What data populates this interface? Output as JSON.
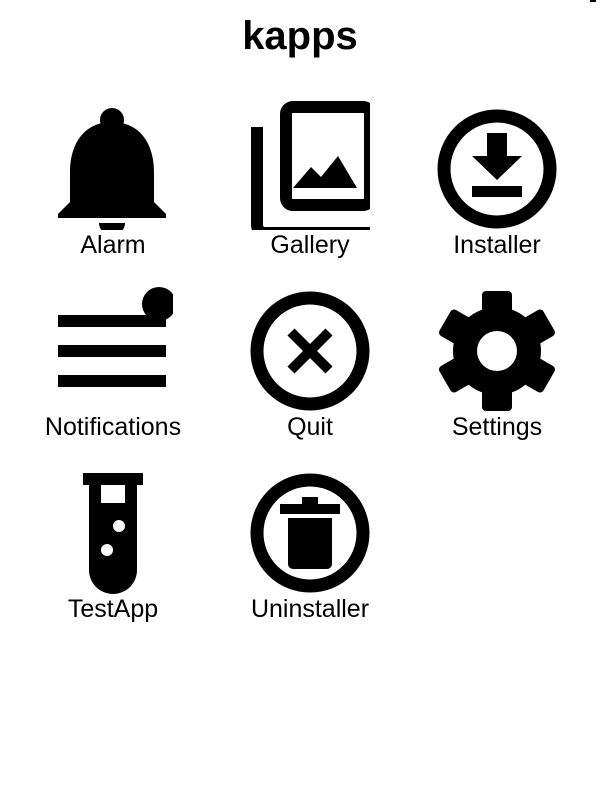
{
  "header": {
    "title": "kapps"
  },
  "apps": [
    {
      "label": "Alarm",
      "icon": "bell-icon"
    },
    {
      "label": "Gallery",
      "icon": "gallery-icon"
    },
    {
      "label": "Installer",
      "icon": "download-icon"
    },
    {
      "label": "Notifications",
      "icon": "notifications-icon"
    },
    {
      "label": "Quit",
      "icon": "close-circle-icon"
    },
    {
      "label": "Settings",
      "icon": "gear-icon"
    },
    {
      "label": "TestApp",
      "icon": "test-tube-icon"
    },
    {
      "label": "Uninstaller",
      "icon": "trash-icon"
    }
  ]
}
